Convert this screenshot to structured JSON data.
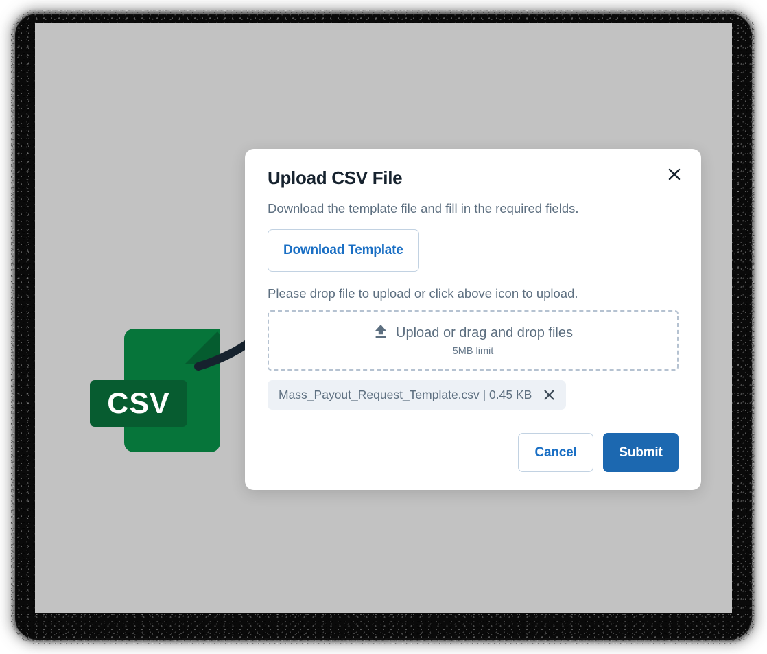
{
  "window": {
    "canvas_background": "#c2c2c2",
    "frame_color": "#0a0a0a"
  },
  "illustration": {
    "file_icon": {
      "name": "csv-file-icon",
      "label": "CSV",
      "body_color": "#06753a",
      "fold_color": "#055c2f",
      "badge_color": "#075c30",
      "label_color": "#ffffff"
    },
    "arrow": {
      "name": "curved-arrow",
      "color": "#16222e",
      "direction": "up-right"
    }
  },
  "modal": {
    "title": "Upload CSV File",
    "description": "Download the template file and fill in the required fields.",
    "close_icon": "close-icon",
    "download_button": {
      "label": "Download Template",
      "text_color": "#1a6fc4",
      "border_color": "#c2d2e2"
    },
    "hint": "Please drop file to upload or click above icon to upload.",
    "dropzone": {
      "icon": "upload-icon",
      "label": "Upload or drag and drop files",
      "sublabel": "5MB limit",
      "border_color": "#b5c2d1"
    },
    "attached_file": {
      "name": "Mass_Payout_Request_Template.csv",
      "separator": "|",
      "size": "0.45 KB",
      "display": "Mass_Payout_Request_Template.csv | 0.45 KB",
      "remove_icon": "close-icon",
      "chip_background": "#edf1f6"
    },
    "actions": {
      "cancel_label": "Cancel",
      "submit_label": "Submit",
      "submit_color": "#1c68b0"
    }
  }
}
